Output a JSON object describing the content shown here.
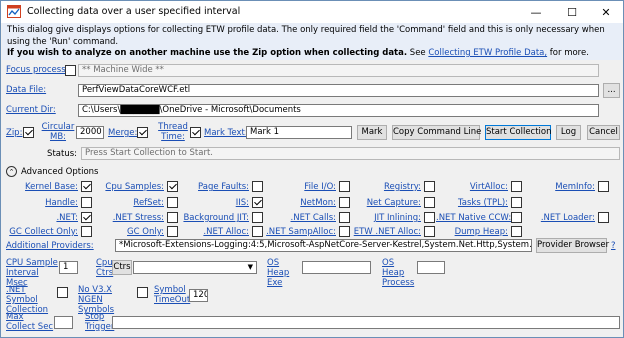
{
  "window": {
    "title": "Collecting data over a user specified interval",
    "minimize_glyph": "—",
    "maximize_glyph": "☐",
    "close_glyph": "✕"
  },
  "description": {
    "line1": "This dialog give displays options for collecting ETW profile data. The only required field the 'Command' field and this is only necessary when using the 'Run' command.",
    "bold": "If you wish to analyze on another machine use the Zip option when collecting data.",
    "see": " See ",
    "link": "Collecting ETW Profile Data,",
    "after": " for more."
  },
  "focus": {
    "label": "Focus process:",
    "checked": false,
    "value": "** Machine Wide **"
  },
  "data_file": {
    "label": "Data File:",
    "value": "PerfViewDataCoreWCF.etl",
    "browse": "..."
  },
  "current_dir": {
    "label": "Current Dir:",
    "value": "C:\\Users\\██████\\OneDrive - Microsoft\\Documents"
  },
  "options_row": {
    "zip_label": "Zip:",
    "zip_checked": true,
    "circular_label": "Circular MB:",
    "circular_value": "2000",
    "merge_label": "Merge:",
    "merge_checked": true,
    "thread_label": "Thread Time:",
    "thread_checked": true,
    "mark_text_label": "Mark Text:",
    "mark_text_value": "Mark 1",
    "mark_btn": "Mark",
    "copy_btn": "Copy Command Line",
    "start_btn": "Start Collection",
    "log_btn": "Log",
    "cancel_btn": "Cancel"
  },
  "status": {
    "label": "Status:",
    "value": "Press Start Collection to Start."
  },
  "advanced": {
    "toggle_glyph": "⌃",
    "label": "Advanced Options"
  },
  "providers_grid": [
    [
      {
        "label": "Kernel Base:",
        "checked": true
      },
      {
        "label": "Cpu Samples:",
        "checked": true
      },
      {
        "label": "Page Faults:",
        "checked": false
      },
      {
        "label": "File I/O:",
        "checked": false
      },
      {
        "label": "Registry:",
        "checked": false
      },
      {
        "label": "VirtAlloc:",
        "checked": false
      },
      {
        "label": "MemInfo:",
        "checked": false
      }
    ],
    [
      {
        "label": "Handle:",
        "checked": false
      },
      {
        "label": "RefSet:",
        "checked": false
      },
      {
        "label": "IIS:",
        "checked": true
      },
      {
        "label": "NetMon:",
        "checked": false
      },
      {
        "label": "Net Capture:",
        "checked": false
      },
      {
        "label": "Tasks (TPL):",
        "checked": false
      },
      null
    ],
    [
      {
        "label": ".NET:",
        "checked": true
      },
      {
        "label": ".NET Stress:",
        "checked": false
      },
      {
        "label": "Background JIT:",
        "checked": false
      },
      {
        "label": ".NET Calls:",
        "checked": false
      },
      {
        "label": "JIT Inlining:",
        "checked": false
      },
      {
        "label": ".NET Native CCW:",
        "checked": false
      },
      {
        "label": ".NET Loader:",
        "checked": false
      }
    ],
    [
      {
        "label": "GC Collect Only:",
        "checked": false
      },
      {
        "label": "GC Only:",
        "checked": false
      },
      {
        "label": ".NET Alloc:",
        "checked": false
      },
      {
        "label": ".NET SampAlloc:",
        "checked": false
      },
      {
        "label": "ETW .NET Alloc:",
        "checked": false
      },
      {
        "label": "Dump Heap:",
        "checked": false
      },
      null
    ]
  ],
  "additional_providers": {
    "label": "Additional Providers:",
    "value": "*Microsoft-Extensions-Logging:4:5,Microsoft-AspNetCore-Server-Kestrel,System.Net.Http,System.Net.Sockets,System",
    "browser_btn": "Provider Browser",
    "help": "?"
  },
  "cpu_sample": {
    "label": "CPU Sample Interval Msec",
    "value": "1"
  },
  "cpu_ctrs": {
    "label": "Cpu Ctrs",
    "button": "Ctrs",
    "value": ""
  },
  "os_heap_exe": {
    "label": "OS Heap Exe",
    "value": ""
  },
  "os_heap_process": {
    "label": "OS Heap Process",
    "value": ""
  },
  "net_symbol": {
    "label": ".NET Symbol Collection",
    "checked": false
  },
  "no_v3x": {
    "label": "No V3.X NGEN Symbols",
    "checked": false
  },
  "symbol_timeout": {
    "label": "Symbol TimeOut",
    "value": "120"
  },
  "max_collect": {
    "label": "Max Collect Sec",
    "value": ""
  },
  "stop_trigger": {
    "label": "Stop Trigger",
    "value": ""
  }
}
